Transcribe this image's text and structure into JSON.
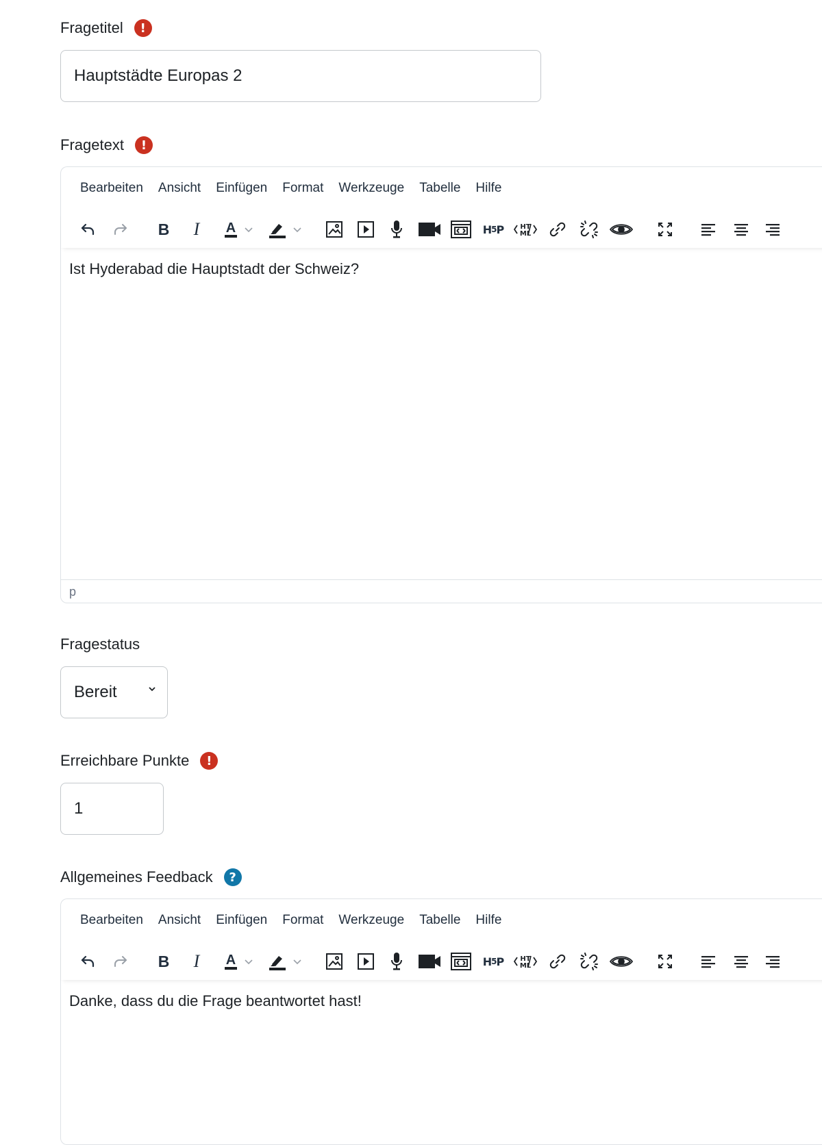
{
  "fields": {
    "title": {
      "label": "Fragetitel",
      "value": "Hauptstädte Europas 2"
    },
    "text": {
      "label": "Fragetext"
    },
    "status": {
      "label": "Fragestatus",
      "value": "Bereit"
    },
    "points": {
      "label": "Erreichbare Punkte",
      "value": "1"
    },
    "feedback": {
      "label": "Allgemeines Feedback"
    }
  },
  "badges": {
    "required": "!",
    "help": "?"
  },
  "editor_menu": [
    "Bearbeiten",
    "Ansicht",
    "Einfügen",
    "Format",
    "Werkzeuge",
    "Tabelle",
    "Hilfe"
  ],
  "toolbar": {
    "bold": "B",
    "italic": "I",
    "textcolor": "A",
    "icons": [
      "undo-icon",
      "redo-icon",
      "bold-icon",
      "italic-icon",
      "text-color-icon",
      "highlight-icon",
      "image-icon",
      "media-icon",
      "microphone-icon",
      "video-camera-icon",
      "embed-icon",
      "h5p-icon",
      "html-icon",
      "link-icon",
      "unlink-icon",
      "preview-icon",
      "fullscreen-icon",
      "align-left-icon",
      "align-center-icon",
      "align-right-icon"
    ]
  },
  "editors": {
    "question": {
      "content": "Ist Hyderabad die Hauptstadt der Schweiz?",
      "statusbar": "p"
    },
    "feedback": {
      "content": "Danke, dass du die Frage beantwortet hast!"
    }
  },
  "colors": {
    "required_badge": "#ca3120",
    "help_badge": "#1177a8",
    "border": "#c4c8cc"
  }
}
